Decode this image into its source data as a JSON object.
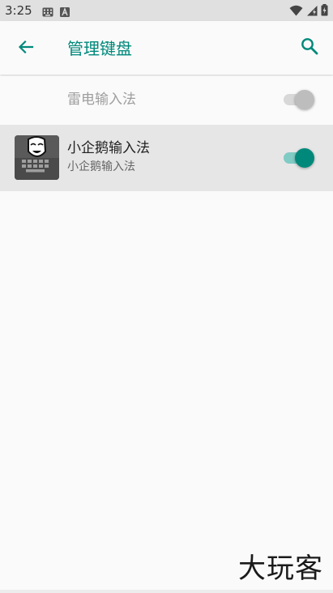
{
  "status_bar": {
    "time": "3:25",
    "icons": [
      "keyboard-icon",
      "text-a-icon",
      "wifi-icon",
      "signal-icon",
      "battery-icon"
    ]
  },
  "app_bar": {
    "title": "管理键盘",
    "back_icon": "arrow-back-icon",
    "search_icon": "search-icon"
  },
  "keyboards": [
    {
      "title": "雷电输入法",
      "summary": "",
      "enabled": false
    },
    {
      "title": "小企鹅输入法",
      "summary": "小企鹅输入法",
      "enabled": true
    }
  ],
  "watermark": "大玩客",
  "colors": {
    "accent": "#00897b",
    "accent_track": "#80cbc4",
    "status_bar": "#e0e0e0",
    "selected_row": "#e6e6e6"
  }
}
